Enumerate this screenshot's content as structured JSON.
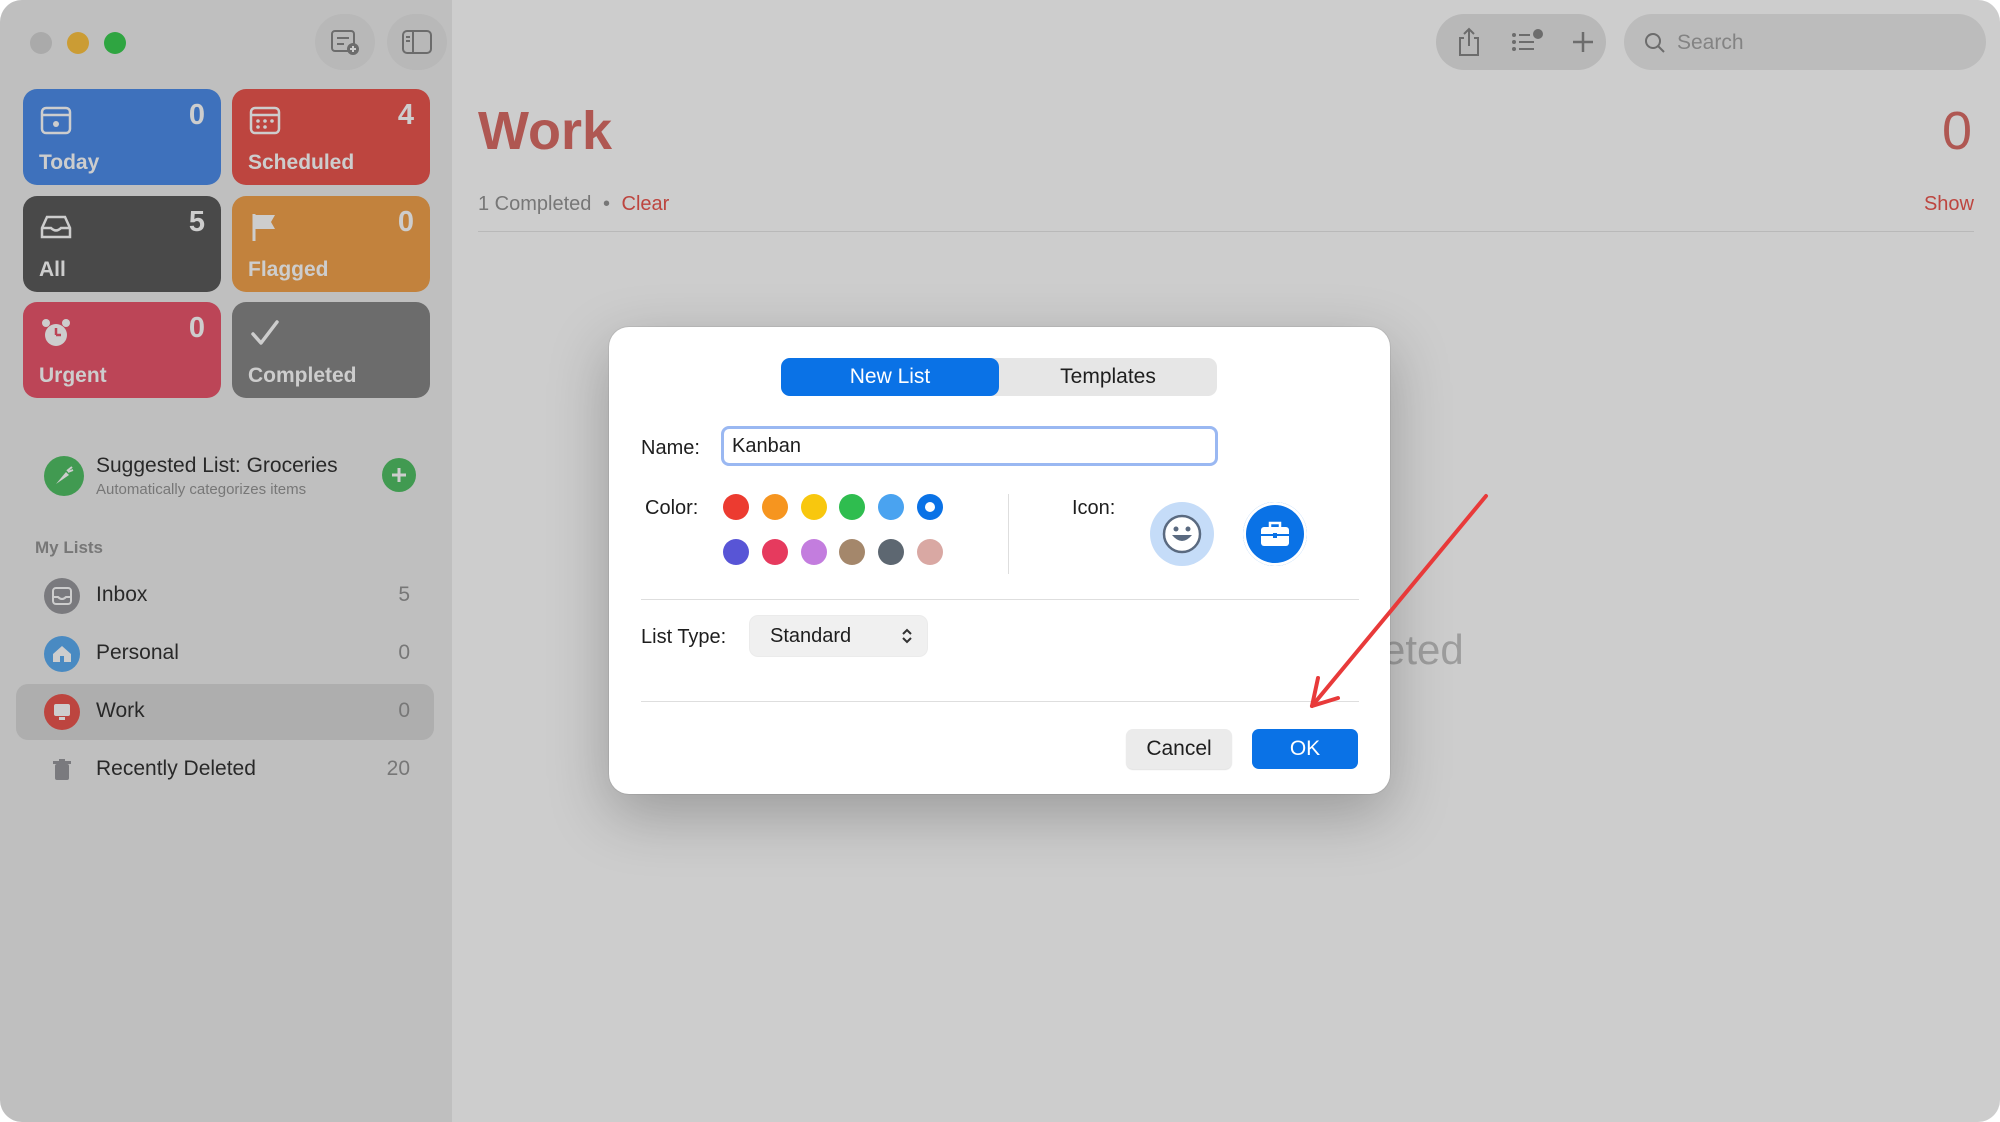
{
  "window": {
    "title": "Work"
  },
  "toolbar": {
    "search_placeholder": "Search"
  },
  "smart_lists": [
    {
      "label": "Today",
      "count": "0",
      "color": "#3b82e8",
      "icon": "calendar-today-icon"
    },
    {
      "label": "Scheduled",
      "count": "4",
      "color": "#e9453d",
      "icon": "calendar-grid-icon"
    },
    {
      "label": "All",
      "count": "5",
      "color": "#4b4b4b",
      "icon": "tray-icon"
    },
    {
      "label": "Flagged",
      "count": "0",
      "color": "#f0993a",
      "icon": "flag-icon"
    },
    {
      "label": "Urgent",
      "count": "0",
      "color": "#e8455e",
      "icon": "alarm-clock-icon"
    },
    {
      "label": "Completed",
      "count": "",
      "color": "#7b7b7b",
      "icon": "checkmark-icon"
    }
  ],
  "suggested": {
    "title": "Suggested List: Groceries",
    "subtitle": "Automatically categorizes items"
  },
  "my_lists": {
    "header": "My Lists",
    "items": [
      {
        "name": "Inbox",
        "count": "5",
        "color": "#8e8e93"
      },
      {
        "name": "Personal",
        "count": "0",
        "color": "#4aa3f0"
      },
      {
        "name": "Work",
        "count": "0",
        "color": "#e9453d"
      },
      {
        "name": "Recently Deleted",
        "count": "20",
        "color": "#8e8e93"
      }
    ]
  },
  "main": {
    "title": "Work",
    "count": "0",
    "completed_text": "1 Completed",
    "bullet": "•",
    "clear_label": "Clear",
    "show_label": "Show",
    "empty_text": "eted"
  },
  "dialog": {
    "tabs": [
      "New List",
      "Templates"
    ],
    "name_label": "Name:",
    "name_value": "Kanban",
    "color_label": "Color:",
    "colors_row1": [
      "#ec3b30",
      "#f6951f",
      "#f8c70e",
      "#2fbd4f",
      "#4aa3f0",
      "#0a72e6"
    ],
    "colors_row2": [
      "#5855d6",
      "#e63a5e",
      "#c37dde",
      "#a4876b",
      "#5d6771",
      "#d9a8a3"
    ],
    "selected_color": "#0a72e6",
    "icon_label": "Icon:",
    "icons": [
      "smiley-icon",
      "briefcase-icon"
    ],
    "list_type_label": "List Type:",
    "list_type_value": "Standard",
    "cancel_label": "Cancel",
    "ok_label": "OK"
  }
}
